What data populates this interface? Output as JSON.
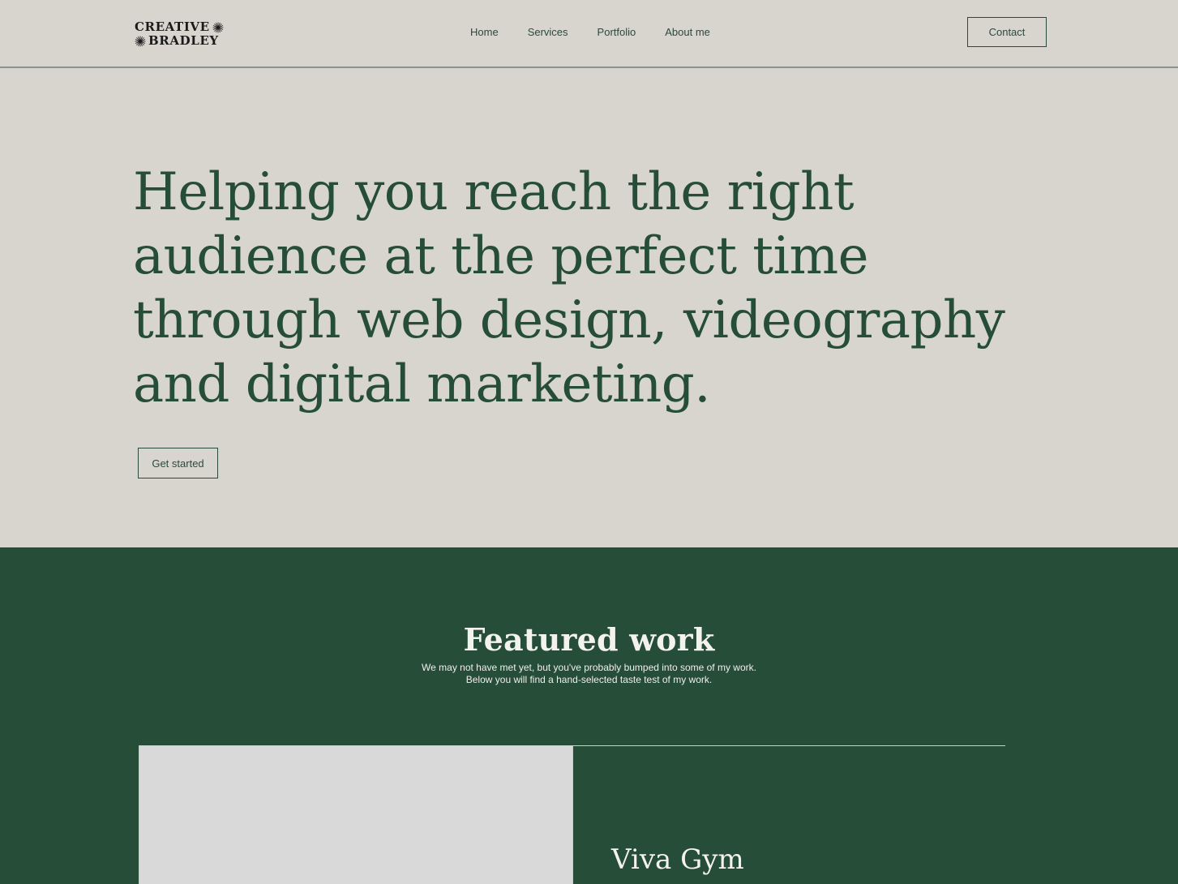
{
  "brand": {
    "logo_line1": "CREATIVE",
    "logo_line2": "BRADLEY",
    "logo_icon": "sunburst-icon"
  },
  "nav": {
    "items": [
      {
        "label": "Home"
      },
      {
        "label": "Services"
      },
      {
        "label": "Portfolio"
      },
      {
        "label": "About me"
      }
    ],
    "contact_label": "Contact"
  },
  "hero": {
    "title": "Helping you reach the right audience at the perfect time through web design, videography and digital marketing.",
    "cta_label": "Get started"
  },
  "featured": {
    "title": "Featured work",
    "subtitle_line1": "We may not have met yet, but you've probably bumped into some of my work.",
    "subtitle_line2": "Below you will find a hand-selected taste test of my work.",
    "items": [
      {
        "name": "Viva Gym"
      }
    ]
  },
  "colors": {
    "background": "#d8d5ce",
    "brand_green": "#264d38",
    "placeholder_gray": "#d9d9d9",
    "light_text": "#f4f2ec"
  }
}
